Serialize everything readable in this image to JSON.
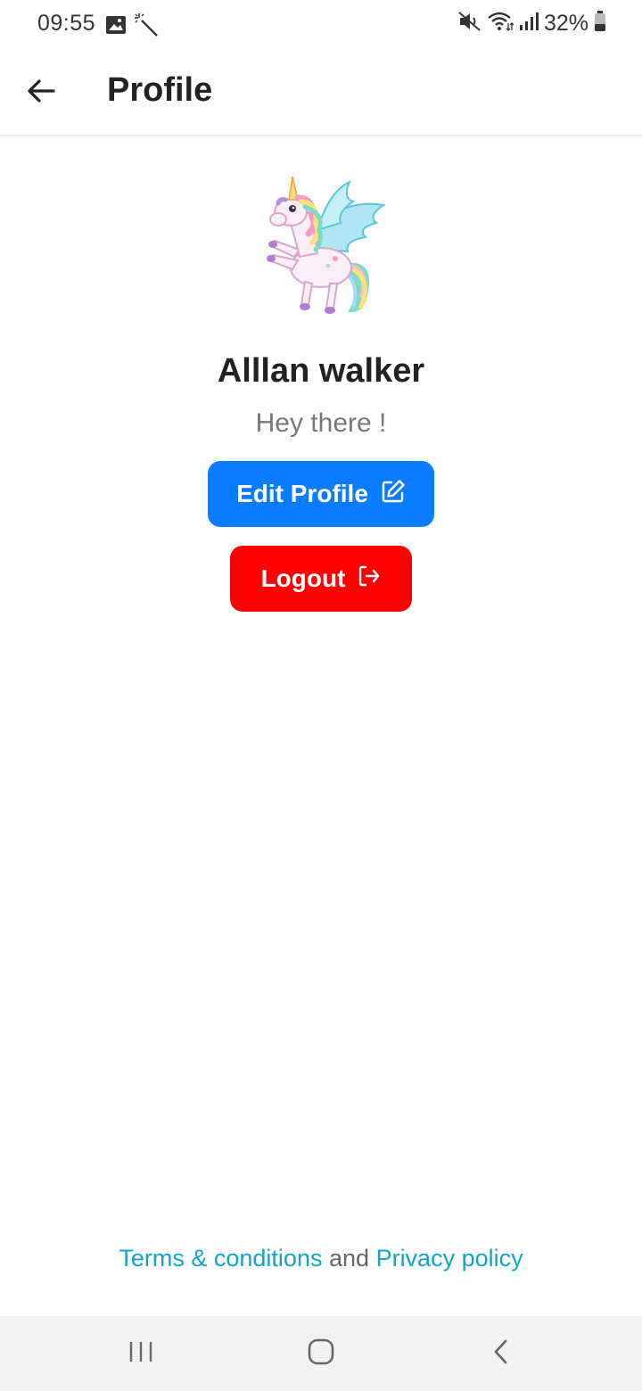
{
  "status_bar": {
    "time": "09:55",
    "battery_percent": "32%",
    "icons": [
      "image-icon",
      "magic-wand-icon",
      "mute-icon",
      "wifi-icon",
      "signal-icon",
      "battery-icon"
    ]
  },
  "app_bar": {
    "title": "Profile"
  },
  "profile": {
    "name": "Alllan walker",
    "status": "Hey there !",
    "avatar": "unicorn-avatar"
  },
  "buttons": {
    "edit_profile": "Edit Profile",
    "logout": "Logout"
  },
  "footer": {
    "terms": "Terms & conditions",
    "and": "and",
    "privacy": "Privacy policy"
  },
  "colors": {
    "edit_button": "#0a7cff",
    "logout_button": "#ff0000",
    "link": "#14a3c7"
  }
}
